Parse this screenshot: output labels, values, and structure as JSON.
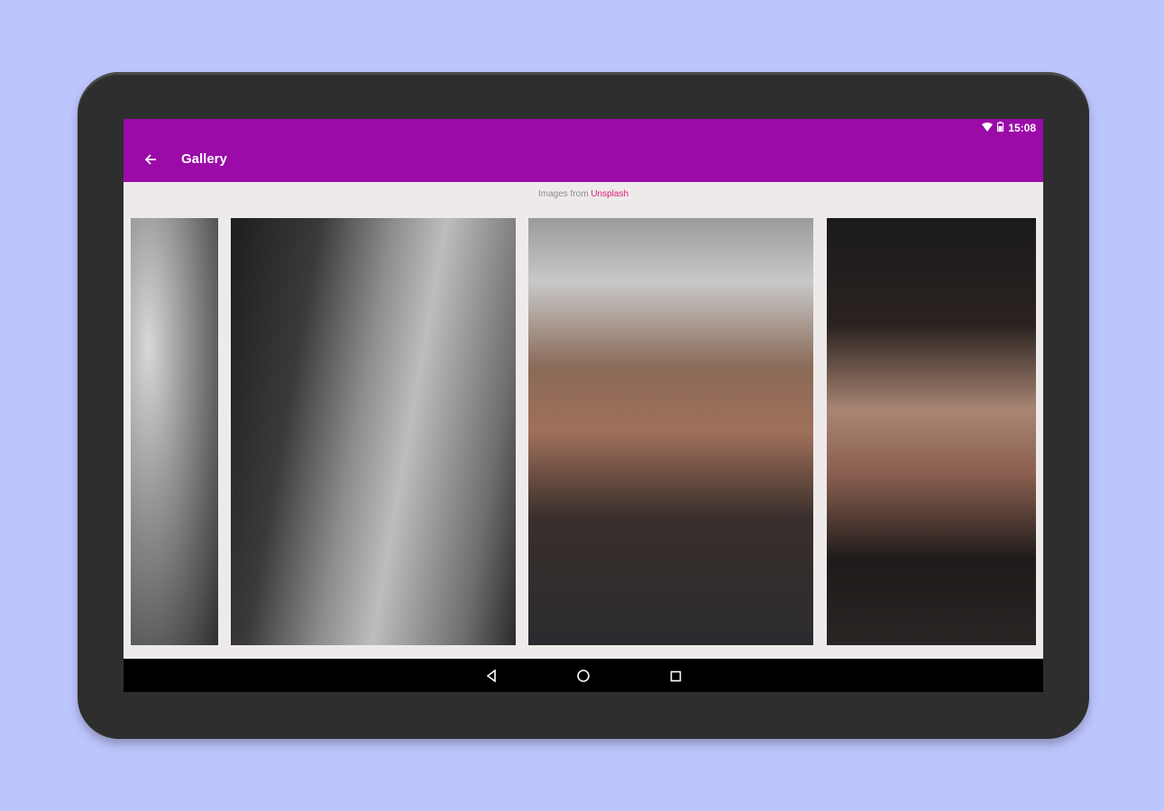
{
  "status": {
    "time": "15:08"
  },
  "appbar": {
    "title": "Gallery"
  },
  "credit": {
    "prefix": "Images from",
    "link": "Unsplash"
  },
  "gallery": {
    "photos": [
      {
        "name": "photo-bearded-man"
      },
      {
        "name": "photo-young-man"
      },
      {
        "name": "photo-boy-hoodie"
      },
      {
        "name": "photo-woman"
      }
    ]
  },
  "colors": {
    "background": "#bdc5fd",
    "appbar": "#9a0ba8",
    "link": "#d8207f"
  }
}
